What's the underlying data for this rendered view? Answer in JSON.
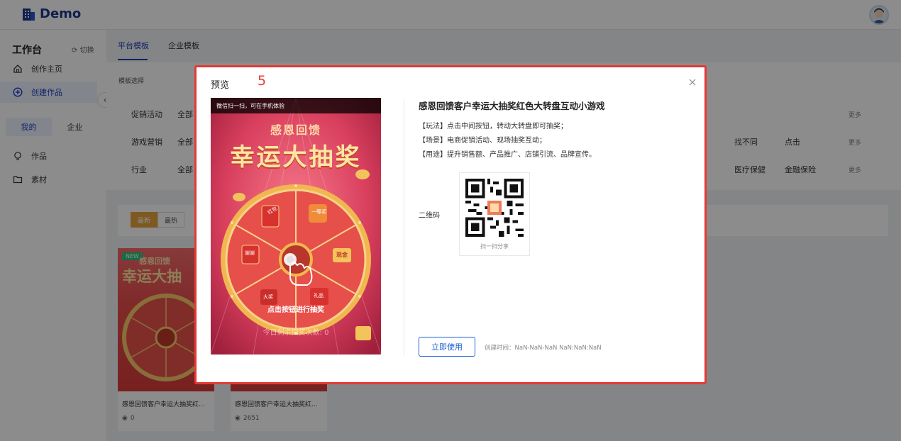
{
  "header": {
    "logo_text": "Demo"
  },
  "sidebar": {
    "title": "工作台",
    "switch_label": "切换",
    "nav": [
      {
        "label": "创作主页",
        "icon": "home-icon"
      },
      {
        "label": "创建作品",
        "icon": "add-circle-icon",
        "active": true
      }
    ],
    "tabs": [
      {
        "label": "我的",
        "active": true
      },
      {
        "label": "企业"
      }
    ],
    "library": [
      {
        "label": "作品",
        "icon": "bulb-icon"
      },
      {
        "label": "素材",
        "icon": "folder-icon"
      }
    ]
  },
  "main": {
    "tabs": [
      {
        "label": "平台模板",
        "active": true
      },
      {
        "label": "企业模板"
      }
    ],
    "section_label": "模板选择",
    "filters": [
      {
        "label": "促销活动",
        "all": "全部",
        "extra": [],
        "more": "更多"
      },
      {
        "label": "游戏营销",
        "all": "全部",
        "extra": [
          "找不同",
          "点击"
        ],
        "more": "更多"
      },
      {
        "label": "行业",
        "all": "全部",
        "extra": [
          "医疗保健",
          "金融保险"
        ],
        "more": "更多"
      }
    ],
    "sort": [
      {
        "label": "最新",
        "active": true
      },
      {
        "label": "最热"
      }
    ],
    "cards": [
      {
        "badge": "NEW",
        "title": "感恩回馈客户幸运大抽奖红...",
        "views": "0",
        "thumb_line1": "感恩回馈",
        "thumb_line2": "幸运大抽"
      },
      {
        "title": "感恩回馈客户幸运大抽奖红...",
        "views": "2651"
      }
    ]
  },
  "modal": {
    "title": "预览",
    "step": "5",
    "preview": {
      "hint": "微信扫一扫，可在手机体验",
      "title_line1": "感恩回馈",
      "title_line2": "幸运大抽奖",
      "cta": "点击按钮进行抽奖",
      "remaining": "今日剩余抽奖次数: 0",
      "segments": [
        "红包",
        "一等奖",
        "现金",
        "谢谢",
        "大奖",
        "礼品"
      ]
    },
    "info": {
      "title": "感恩回馈客户幸运大抽奖红色大转盘互动小游戏",
      "lines": [
        "【玩法】点击中间按钮，转动大转盘即可抽奖；",
        "【场景】电商促销活动、现场抽奖互动；",
        "【用途】提升销售额、产品推广、店铺引流、品牌宣传。"
      ],
      "qr_label": "二维码",
      "qr_caption": "扫一扫分享",
      "use_button": "立即使用",
      "created": "创建时间：NaN-NaN-NaN NaN:NaN:NaN"
    }
  },
  "colors": {
    "primary": "#1a3fbf",
    "accent_red": "#e53935",
    "sort_active": "#e6a23c"
  }
}
